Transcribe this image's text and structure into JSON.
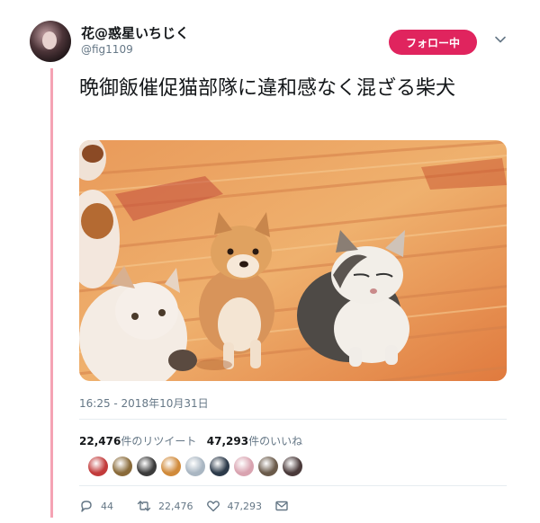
{
  "tweet": {
    "display_name": "花@惑星いちじく",
    "handle": "@fig1109",
    "follow_button_label": "フォロー中",
    "text": "晩御飯催促猫部隊に違和感なく混ざる柴犬",
    "timestamp": "16:25 - 2018年10月31日",
    "retweet_count": "22,476",
    "retweet_label": "件のリツイート",
    "like_count": "47,293",
    "like_label": "件のいいね",
    "actions": {
      "reply_count": "44",
      "retweet_count": "22,476",
      "like_count": "47,293"
    }
  },
  "liker_colors": [
    "#c23b3b",
    "#8a6b3a",
    "#3b3b3b",
    "#d08a3a",
    "#a9b6c2",
    "#2c3a4a",
    "#d9a3b0",
    "#6a5a4a",
    "#4a3a3a"
  ],
  "colors": {
    "accent": "#e0245e",
    "thread_line": "#f5a3b4",
    "secondary_text": "#657786"
  }
}
